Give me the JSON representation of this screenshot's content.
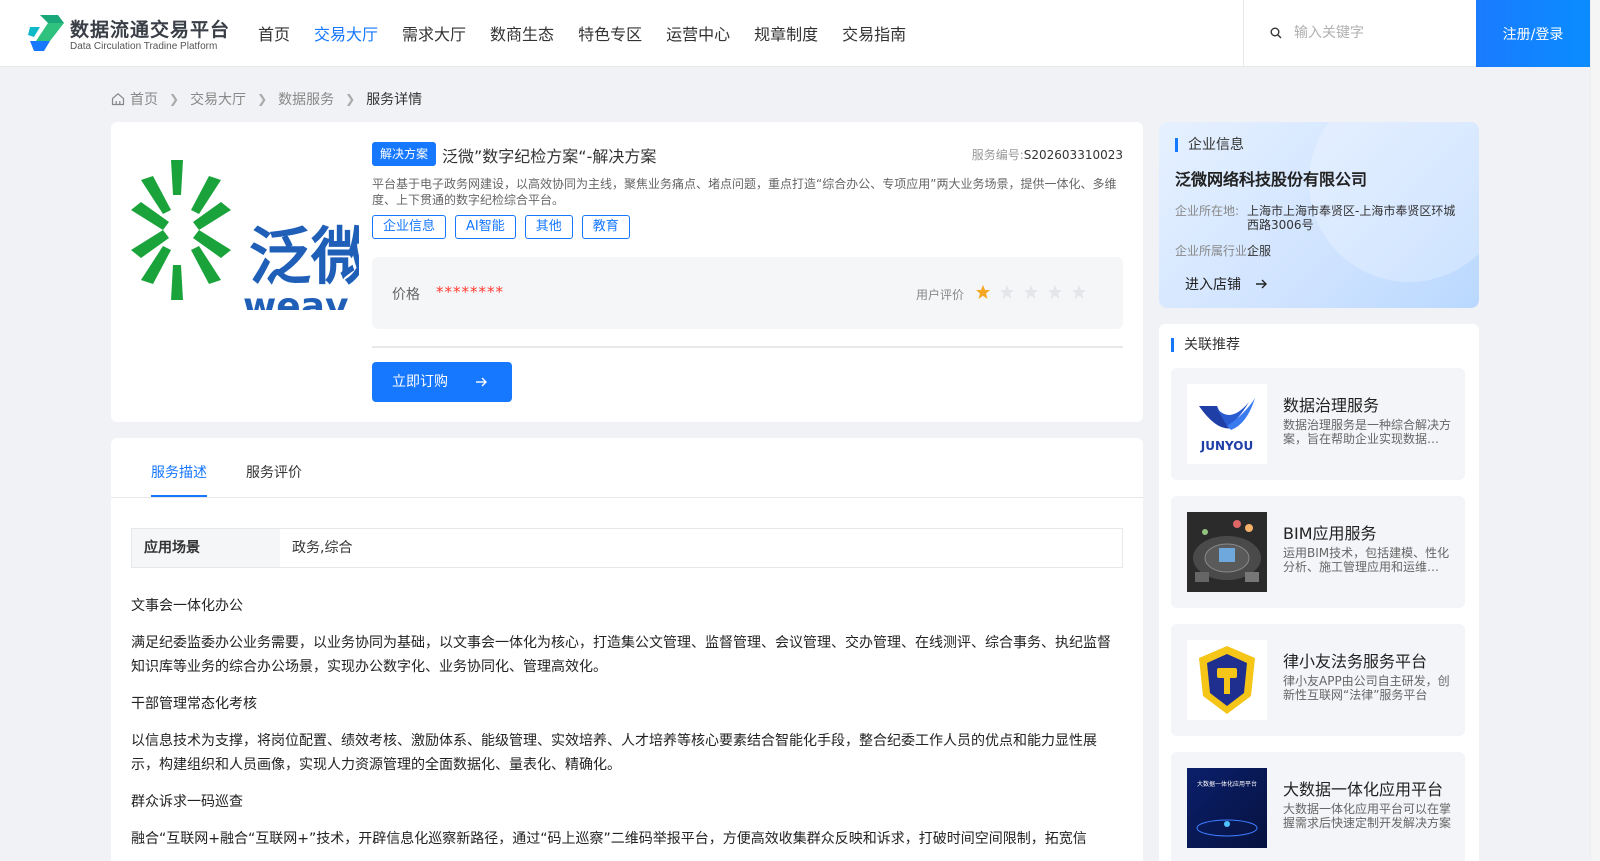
{
  "header": {
    "logo_title": "数据流通交易平台",
    "logo_subtitle": "Data Circulation Tradine Platform",
    "nav": [
      "首页",
      "交易大厅",
      "需求大厅",
      "数商生态",
      "特色专区",
      "运营中心",
      "规章制度",
      "交易指南"
    ],
    "active_nav": "交易大厅",
    "search_placeholder": "输入关键字",
    "login_label": "注册/登录"
  },
  "breadcrumb": [
    "首页",
    "交易大厅",
    "数据服务",
    "服务详情"
  ],
  "service": {
    "logo_text": "泛微",
    "logo_sub": "weav",
    "badge": "解决方案",
    "title": "泛微”数字纪检方案“-解决方案",
    "no_label": "服务编号:",
    "no_value": "S202603310023",
    "description": "平台基于电子政务网建设，以高效协同为主线，聚焦业务痛点、堵点问题，重点打造“综合办公、专项应用”两大业务场景，提供一体化、多维度、上下贯通的数字纪检综合平台。",
    "tags": [
      "企业信息",
      "AI智能",
      "其他",
      "教育"
    ],
    "price_label": "价格",
    "price_value": "********",
    "rating_label": "用户评价",
    "rating": 1,
    "rating_max": 5,
    "order_label": "立即订购"
  },
  "detail": {
    "tabs": [
      "服务描述",
      "服务评价"
    ],
    "active_tab": "服务描述",
    "scene_key": "应用场景",
    "scene_value": "政务,综合",
    "paragraphs": [
      "文事会一体化办公",
      "满足纪委监委办公业务需要，以业务协同为基础，以文事会一体化为核心，打造集公文管理、监督管理、会议管理、交办管理、在线测评、综合事务、执纪监督知识库等业务的综合办公场景，实现办公数字化、业务协同化、管理高效化。",
      "干部管理常态化考核",
      "以信息技术为支撑，将岗位配置、绩效考核、激励体系、能级管理、实效培养、人才培养等核心要素结合智能化手段，整合纪委工作人员的优点和能力显性展示，构建组织和人员画像，实现人力资源管理的全面数据化、量表化、精确化。",
      "群众诉求一码巡查",
      "融合“互联网+融合“互联网+”技术，开辟信息化巡察新路径，通过“码上巡察”二维码举报平台，方便高效收集群众反映和诉求，打破时间空间限制，拓宽信"
    ]
  },
  "enterprise": {
    "section_title": "企业信息",
    "name": "泛微网络科技股份有限公司",
    "location_label": "企业所在地:",
    "location_value": "上海市上海市奉贤区-上海市奉贤区环城西路3006号",
    "industry_label": "企业所属行业:",
    "industry_value": "企服",
    "enter_label": "进入店铺"
  },
  "recommend": {
    "section_title": "关联推荐",
    "items": [
      {
        "title": "数据治理服务",
        "desc": "数据治理服务是一种综合解决方案，旨在帮助企业实现数据资产的有效管理",
        "thumb": "junyou-logo",
        "thumb_text": "JUNYOU"
      },
      {
        "title": "BIM应用服务",
        "desc": "运用BIM技术，包括建模、性化分析、施工管理应用和运维管理等服务",
        "thumb": "bim-render",
        "thumb_text": ""
      },
      {
        "title": "律小友法务服务平台",
        "desc": "律小友APP由公司自主研发，创新性互联网“法律”服务平台",
        "thumb": "shield-gavel-logo",
        "thumb_text": ""
      },
      {
        "title": "大数据一体化应用平台",
        "desc": "大数据一体化应用平台可以在掌握需求后快速定制开发解决方案",
        "thumb": "bigdata-cover",
        "thumb_text": "大数据一体化应用平台"
      }
    ]
  },
  "colors": {
    "primary": "#1677ff",
    "price": "#ff3b30",
    "star": "#f5a623",
    "logo_green": "#1aa33a",
    "logo_blue": "#1f5fb8"
  }
}
